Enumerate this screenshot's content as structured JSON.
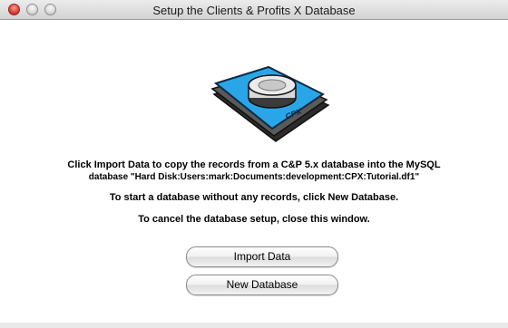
{
  "window": {
    "title": "Setup the Clients & Profits X Database"
  },
  "logo": {
    "icon": "database-disk-icon",
    "label": "CPX",
    "accent_color": "#2aa6e8"
  },
  "messages": {
    "line1": "Click Import Data to copy the records from a C&P 5.x database into the MySQL",
    "line2": "database \"Hard Disk:Users:mark:Documents:development:CPX:Tutorial.df1\"",
    "line3": "To start a database without any records, click New Database.",
    "line4": "To cancel the database setup, close this window."
  },
  "buttons": {
    "import_label": "Import Data",
    "new_database_label": "New Database"
  }
}
